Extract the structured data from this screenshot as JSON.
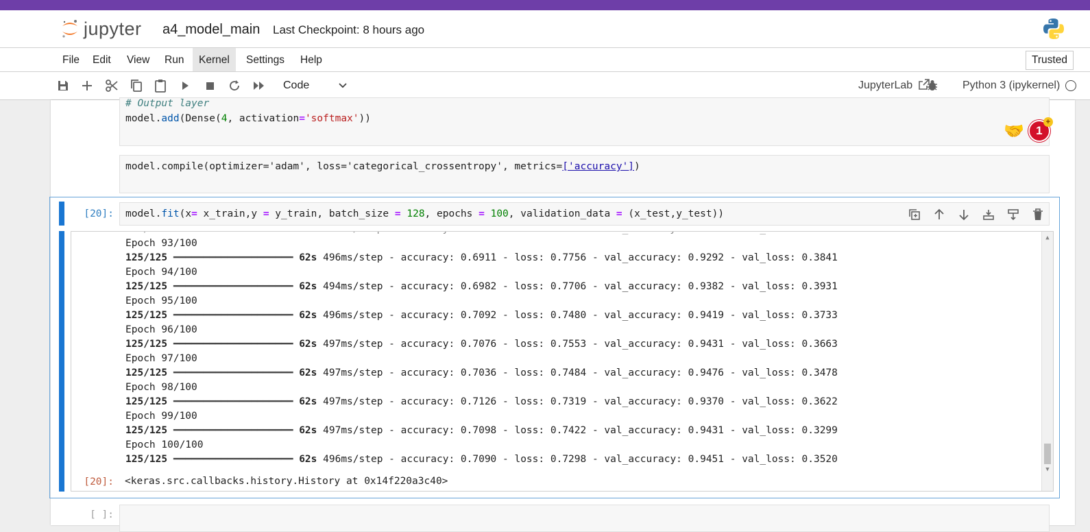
{
  "header": {
    "logo_text": "jupyter",
    "notebook_name": "a4_model_main",
    "checkpoint": "Last Checkpoint: 8 hours ago"
  },
  "menu": {
    "items": [
      "File",
      "Edit",
      "View",
      "Run",
      "Kernel",
      "Settings",
      "Help"
    ],
    "active": "Kernel",
    "trusted": "Trusted"
  },
  "toolbar": {
    "cell_type": "Code",
    "jupyterlab_link": "JupyterLab",
    "kernel_name": "Python 3 (ipykernel)"
  },
  "cells": {
    "cell1": {
      "comment": "# Output layer",
      "code_prefix": "model.",
      "code_fn": "add",
      "code_open": "(Dense(",
      "code_num": "4",
      "code_mid": ", activation",
      "code_eq": "=",
      "code_str": "'softmax'",
      "code_close": "))"
    },
    "cell2": {
      "prefix": "model.compile(optimizer='adam', loss='categorical_crossentropy', metrics=",
      "link": "['accuracy']",
      "suffix": ")"
    },
    "cell3": {
      "prompt_in": "[20]:",
      "prompt_out": "[20]:",
      "code": {
        "p1": "model.",
        "fn": "fit",
        "p2": "(x",
        "eq1": "=",
        "p3": " x_train,y ",
        "eq2": "=",
        "p4": " y_train, batch_size ",
        "eq3": "=",
        "n1": " 128",
        "p5": ", epochs ",
        "eq4": "=",
        "n2": " 100",
        "p6": ", validation_data ",
        "eq5": "=",
        "p7": " (x_test,y_test))"
      },
      "output_lines": [
        {
          "epoch": "Epoch 93/100",
          "steps": "125/125",
          "bar": "━━━━━━━━━━━━━━━━━━━━",
          "time": "62s",
          "stats": "496ms/step - accuracy: 0.6911 - loss: 0.7756 - val_accuracy: 0.9292 - val_loss: 0.3841"
        },
        {
          "epoch": "Epoch 94/100",
          "steps": "125/125",
          "bar": "━━━━━━━━━━━━━━━━━━━━",
          "time": "62s",
          "stats": "494ms/step - accuracy: 0.6982 - loss: 0.7706 - val_accuracy: 0.9382 - val_loss: 0.3931"
        },
        {
          "epoch": "Epoch 95/100",
          "steps": "125/125",
          "bar": "━━━━━━━━━━━━━━━━━━━━",
          "time": "62s",
          "stats": "496ms/step - accuracy: 0.7092 - loss: 0.7480 - val_accuracy: 0.9419 - val_loss: 0.3733"
        },
        {
          "epoch": "Epoch 96/100",
          "steps": "125/125",
          "bar": "━━━━━━━━━━━━━━━━━━━━",
          "time": "62s",
          "stats": "497ms/step - accuracy: 0.7076 - loss: 0.7553 - val_accuracy: 0.9431 - val_loss: 0.3663"
        },
        {
          "epoch": "Epoch 97/100",
          "steps": "125/125",
          "bar": "━━━━━━━━━━━━━━━━━━━━",
          "time": "62s",
          "stats": "497ms/step - accuracy: 0.7036 - loss: 0.7484 - val_accuracy: 0.9476 - val_loss: 0.3478"
        },
        {
          "epoch": "Epoch 98/100",
          "steps": "125/125",
          "bar": "━━━━━━━━━━━━━━━━━━━━",
          "time": "62s",
          "stats": "497ms/step - accuracy: 0.7126 - loss: 0.7319 - val_accuracy: 0.9370 - val_loss: 0.3622"
        },
        {
          "epoch": "Epoch 99/100",
          "steps": "125/125",
          "bar": "━━━━━━━━━━━━━━━━━━━━",
          "time": "62s",
          "stats": "497ms/step - accuracy: 0.7098 - loss: 0.7422 - val_accuracy: 0.9431 - val_loss: 0.3299"
        },
        {
          "epoch": "Epoch 100/100",
          "steps": "125/125",
          "bar": "━━━━━━━━━━━━━━━━━━━━",
          "time": "62s",
          "stats": "496ms/step - accuracy: 0.7090 - loss: 0.7298 - val_accuracy: 0.9451 - val_loss: 0.3520"
        }
      ],
      "result": "<keras.src.callbacks.history.History at 0x14f220a3c40>"
    },
    "cell4": {
      "prompt_in": "[ ]:"
    }
  },
  "collab": {
    "badge_count": "1",
    "badge_plus": "+"
  },
  "colors": {
    "top_strip": "#6e3ea8",
    "active_cell": "#1976d2",
    "string": "#ba2121",
    "number": "#008000",
    "operator": "#aa22ff"
  },
  "icons": [
    "save-icon",
    "add-icon",
    "cut-icon",
    "copy-icon",
    "paste-icon",
    "run-icon",
    "stop-icon",
    "restart-icon",
    "fast-forward-icon",
    "chevron-down-icon",
    "external-link-icon",
    "bug-icon",
    "duplicate-icon",
    "arrow-up-icon",
    "arrow-down-icon",
    "insert-below-icon",
    "merge-icon",
    "trash-icon",
    "python-logo-icon",
    "handshake-icon"
  ]
}
